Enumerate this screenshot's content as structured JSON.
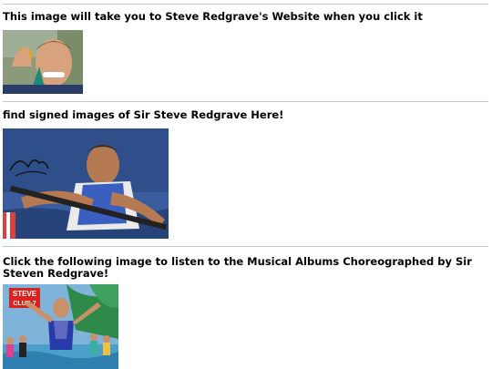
{
  "sections": [
    {
      "caption": "This image will take you to Steve Redgrave's Website when you click it"
    },
    {
      "caption": "find signed images of Sir Steve Redgrave Here!"
    },
    {
      "caption": "Click the following image to listen to the Musical Albums Choreographed by Sir Steven Redgrave!"
    }
  ],
  "images": {
    "club_logo_text_1": "STEVE",
    "club_logo_text_2": "CLUB 7"
  },
  "colors": {
    "divider": "#c8c8c8",
    "text": "#000000",
    "water_blue": "#2f4f8a",
    "club_red": "#d9231f"
  }
}
